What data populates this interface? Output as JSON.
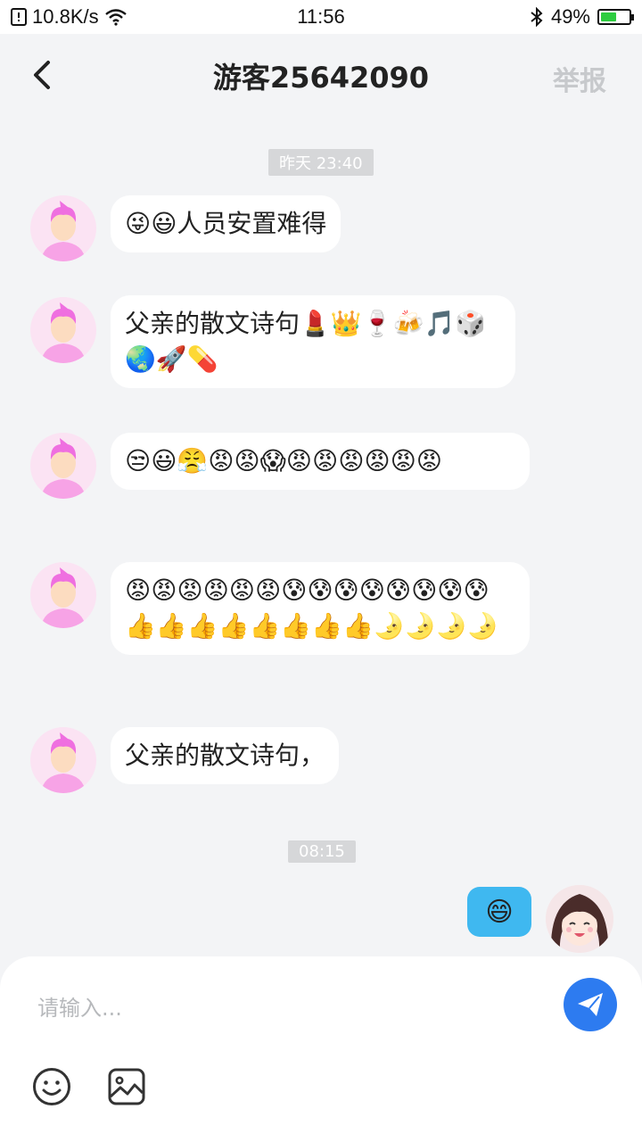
{
  "status_bar": {
    "net_speed": "10.8K/s",
    "time": "11:56",
    "battery": "49%",
    "battery_level": 0.49
  },
  "nav": {
    "title": "游客25642090",
    "report_label": "举报"
  },
  "timestamps": [
    "昨天 23:40",
    "08:15"
  ],
  "messages": [
    {
      "from": "other",
      "text": "😜😃人员安置难得"
    },
    {
      "from": "other",
      "text": "父亲的散文诗句💄👑🍷🍻🎵🎲🌏🚀💊"
    },
    {
      "from": "other",
      "text": "😒😃😤😡😡😱😡😡😡😡😡😡"
    },
    {
      "from": "other",
      "text": "😡😡😡😡😡😡😰😰😰😰😰😰😰😰👍👍👍👍👍👍👍👍🌛🌛🌛🌛"
    },
    {
      "from": "other",
      "text": "父亲的散文诗句，"
    },
    {
      "from": "me",
      "text": "😄"
    }
  ],
  "composer": {
    "placeholder": "请输入..."
  },
  "icons": {
    "back": "chevron-left-icon",
    "send": "send-icon",
    "emoji": "emoji-icon",
    "image": "image-icon",
    "wifi": "wifi-icon",
    "bluetooth": "bluetooth-icon"
  },
  "colors": {
    "accent": "#2d7bf0",
    "my_bubble": "#3fb8f0",
    "avatar_bg": "#fbe3f3"
  }
}
